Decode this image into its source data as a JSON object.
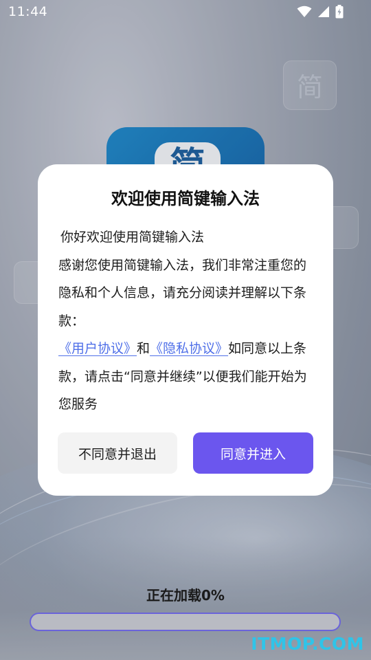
{
  "status_bar": {
    "time": "11:44",
    "icons": [
      "wifi-icon",
      "cell-signal-icon",
      "battery-charging-icon"
    ]
  },
  "background": {
    "logo_glyph": "简",
    "key_glyph": "简"
  },
  "dialog": {
    "title": "欢迎使用简键输入法",
    "greeting": "你好欢迎使用简键输入法",
    "intro": "感谢您使用简键输入法，我们非常注重您的隐私和个人信息，请充分阅读并理解以下条款：",
    "link_user_agreement": "《用户协议》",
    "and_text": "和",
    "link_privacy_agreement": "《隐私协议》",
    "consent_text": "如同意以上条款，请点击“同意并继续”以便我们能开始为您服务",
    "decline_button": "不同意并退出",
    "accept_button": "同意并进入"
  },
  "loading": {
    "label": "正在加载0%",
    "progress_percent": 0
  },
  "watermark": "ITMOP.COM",
  "colors": {
    "accent": "#6b56ee",
    "link": "#4f6fe8",
    "decline_bg": "#f3f3f3",
    "watermark": "#2fc4e8"
  }
}
